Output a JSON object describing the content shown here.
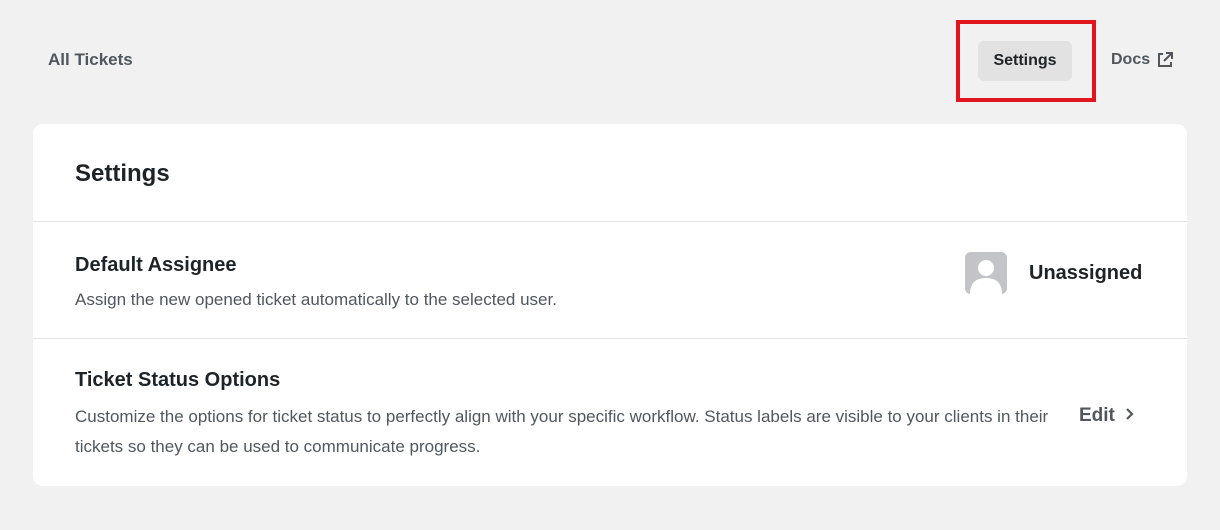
{
  "nav": {
    "all_tickets": "All Tickets",
    "settings": "Settings",
    "docs": "Docs",
    "docs_icon": "external-link-icon"
  },
  "colors": {
    "background": "#f1f1f1",
    "card": "#ffffff",
    "highlight": "#e0161e",
    "active_tab": "#e2e2e2"
  },
  "settings_card": {
    "title": "Settings",
    "default_assignee": {
      "title": "Default Assignee",
      "description": "Assign the new opened ticket automatically to the selected user.",
      "value": "Unassigned",
      "avatar_icon": "user-avatar-icon"
    },
    "ticket_status": {
      "title": "Ticket Status Options",
      "description": "Customize the options for ticket status to perfectly align with your specific workflow. Status labels are visible to your clients in their tickets so they can be used to communicate progress.",
      "edit_label": "Edit",
      "edit_icon": "chevron-right-icon"
    }
  }
}
